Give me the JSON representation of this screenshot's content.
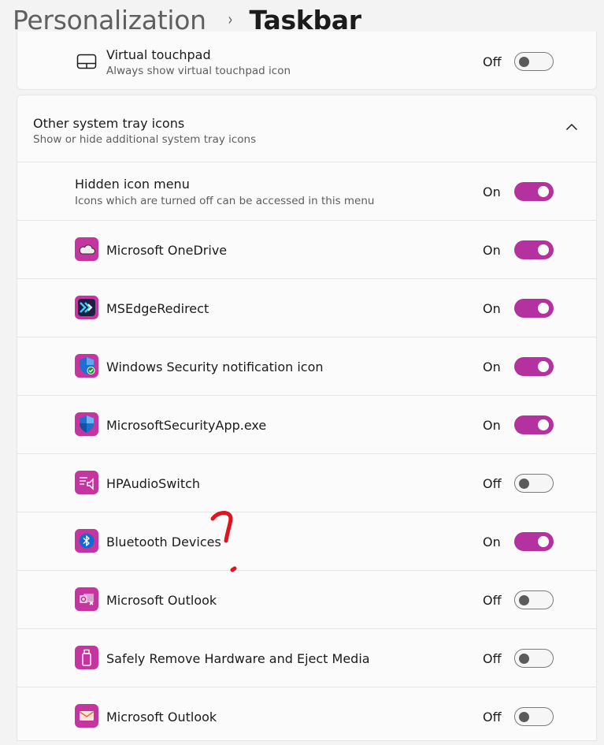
{
  "breadcrumb": {
    "parent": "Personalization",
    "separator": "›",
    "current": "Taskbar"
  },
  "virtual_touchpad": {
    "title": "Virtual touchpad",
    "subtitle": "Always show virtual touchpad icon",
    "state": "Off",
    "on": false,
    "icon": "touchpad-icon"
  },
  "tray_section": {
    "title": "Other system tray icons",
    "subtitle": "Show or hide additional system tray icons",
    "expanded": true
  },
  "hidden_icon_menu": {
    "title": "Hidden icon menu",
    "subtitle": "Icons which are turned off can be accessed in this menu",
    "state": "On",
    "on": true
  },
  "apps": [
    {
      "name": "Microsoft OneDrive",
      "state": "On",
      "on": true,
      "icon": "onedrive-icon"
    },
    {
      "name": "MSEdgeRedirect",
      "state": "On",
      "on": true,
      "icon": "edge-redirect-icon"
    },
    {
      "name": "Windows Security notification icon",
      "state": "On",
      "on": true,
      "icon": "windows-security-icon"
    },
    {
      "name": "MicrosoftSecurityApp.exe",
      "state": "On",
      "on": true,
      "icon": "security-shield-icon"
    },
    {
      "name": "HPAudioSwitch",
      "state": "Off",
      "on": false,
      "icon": "audio-switch-icon"
    },
    {
      "name": "Bluetooth Devices",
      "state": "On",
      "on": true,
      "icon": "bluetooth-icon"
    },
    {
      "name": "Microsoft Outlook",
      "state": "Off",
      "on": false,
      "icon": "outlook-icon"
    },
    {
      "name": "Safely Remove Hardware and Eject Media",
      "state": "Off",
      "on": false,
      "icon": "usb-drive-icon"
    },
    {
      "name": "Microsoft Outlook",
      "state": "Off",
      "on": false,
      "icon": "mail-icon"
    }
  ],
  "colors": {
    "accent": "#b4329f",
    "icon_bg": "#c5359f",
    "annotation": "#e0141e"
  }
}
